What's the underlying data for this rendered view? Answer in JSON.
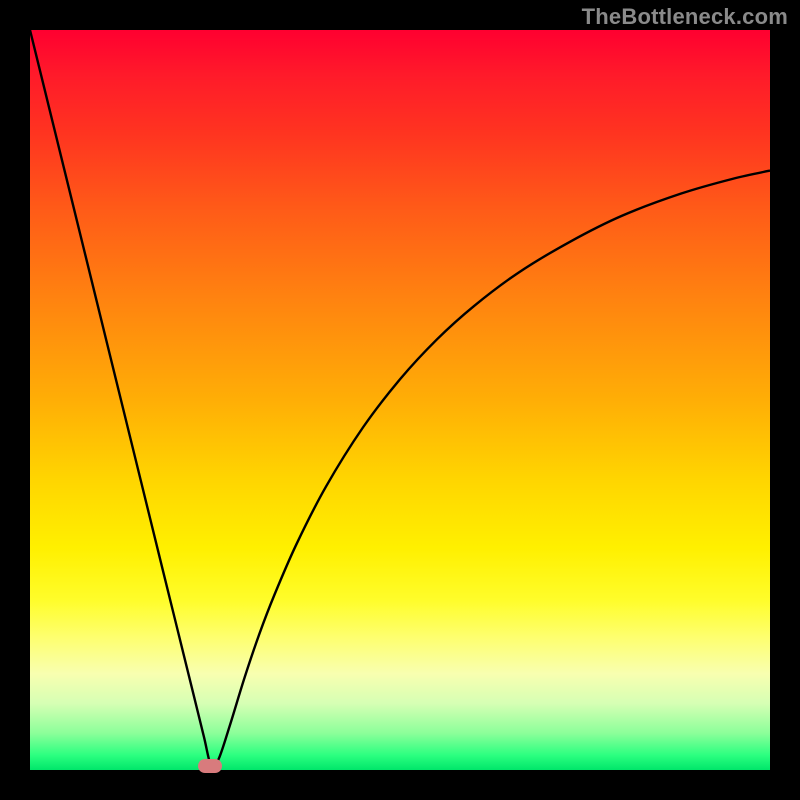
{
  "watermark": "TheBottleneck.com",
  "chart_data": {
    "type": "line",
    "title": "",
    "xlabel": "",
    "ylabel": "",
    "xlim": [
      0,
      100
    ],
    "ylim": [
      0,
      100
    ],
    "x": [
      0,
      3,
      6,
      9,
      12,
      15,
      18,
      20,
      22,
      23.5,
      24.5,
      25.5,
      27,
      29,
      31,
      33,
      36,
      40,
      45,
      50,
      55,
      60,
      66,
      73,
      80,
      88,
      95,
      100
    ],
    "y": [
      100,
      87.8,
      75.6,
      63.4,
      51.2,
      39.0,
      26.8,
      18.7,
      10.6,
      4.5,
      0.5,
      1.5,
      6.0,
      12.5,
      18.4,
      23.6,
      30.5,
      38.3,
      46.3,
      52.8,
      58.2,
      62.7,
      67.2,
      71.4,
      74.9,
      77.9,
      79.9,
      81.0
    ],
    "marker": {
      "x_pct": 24.3,
      "y_pct": 0.5
    },
    "gradient_colors": {
      "top": "#ff0030",
      "mid": "#ffd600",
      "bottom": "#00e66a"
    }
  }
}
